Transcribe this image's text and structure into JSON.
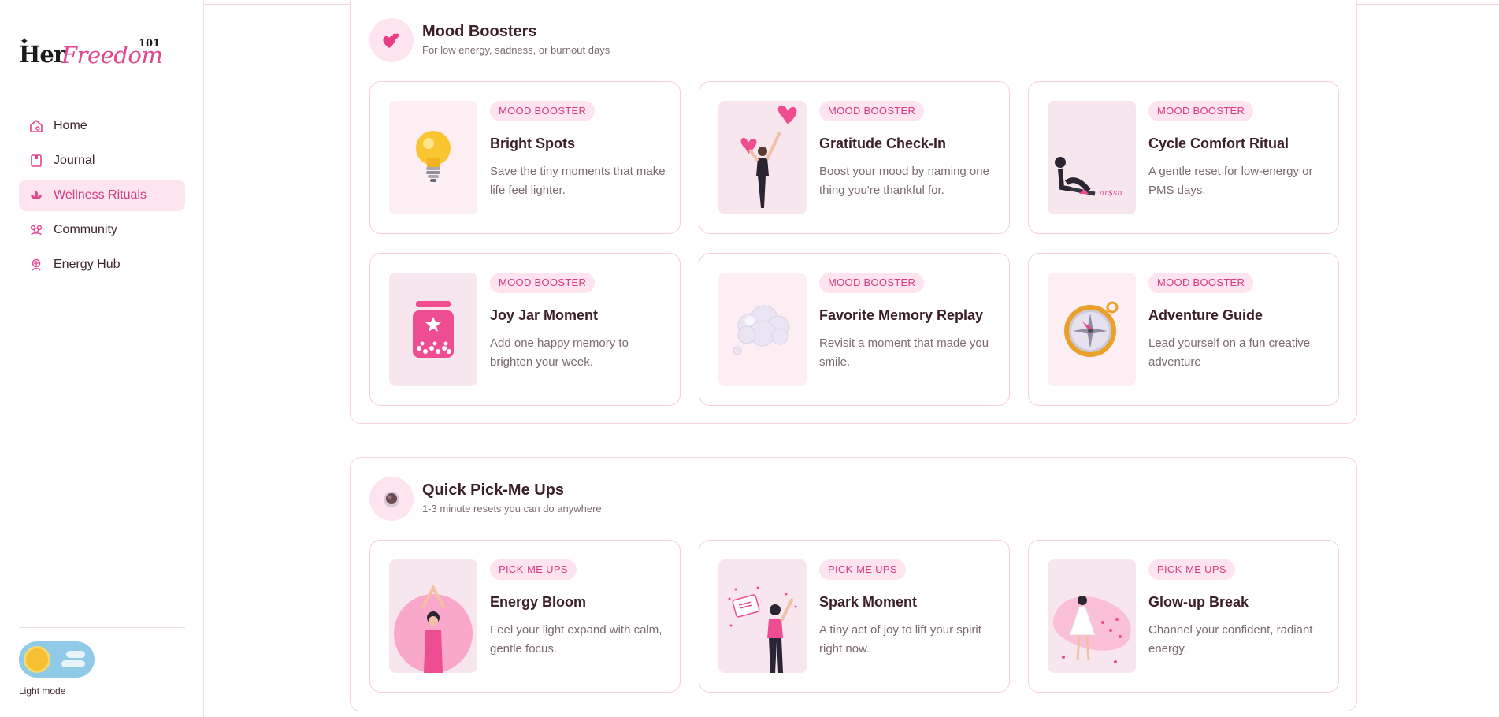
{
  "sidebar": {
    "logo": {
      "her": "Her",
      "freedom": "Freedom",
      "num": "101"
    },
    "items": [
      {
        "label": "Home",
        "icon": "home-icon",
        "active": false
      },
      {
        "label": "Journal",
        "icon": "journal-icon",
        "active": false
      },
      {
        "label": "Wellness Rituals",
        "icon": "lotus-icon",
        "active": true
      },
      {
        "label": "Community",
        "icon": "community-icon",
        "active": false
      },
      {
        "label": "Energy Hub",
        "icon": "energy-icon",
        "active": false
      }
    ],
    "mode_label": "Light mode"
  },
  "colors": {
    "accent": "#d63a82",
    "badge_bg": "#fde4ef",
    "border": "#f6cfdf",
    "toggle": "#8fcbe6"
  },
  "sections": [
    {
      "title": "Mood Boosters",
      "subtitle": "For low energy, sadness, or burnout days",
      "icon": "hearts-icon",
      "cards": [
        {
          "badge": "MOOD BOOSTER",
          "title": "Bright Spots",
          "desc": "Save the tiny moments that make life feel lighter.",
          "icon": "lightbulb-icon"
        },
        {
          "badge": "MOOD BOOSTER",
          "title": "Gratitude Check-In",
          "desc": "Boost your mood by naming one thing you're thankful for.",
          "icon": "woman-hearts-illustration"
        },
        {
          "badge": "MOOD BOOSTER",
          "title": "Cycle Comfort Ritual",
          "desc": "A gentle reset for low-energy or PMS days.",
          "icon": "woman-sitting-illustration"
        },
        {
          "badge": "MOOD BOOSTER",
          "title": "Joy Jar Moment",
          "desc": "Add one happy memory to brighten your week.",
          "icon": "jar-icon"
        },
        {
          "badge": "MOOD BOOSTER",
          "title": "Favorite Memory Replay",
          "desc": "Revisit a moment that made you smile.",
          "icon": "thought-cloud-icon"
        },
        {
          "badge": "MOOD BOOSTER",
          "title": "Adventure Guide",
          "desc": "Lead yourself on a fun creative adventure",
          "icon": "compass-icon"
        }
      ]
    },
    {
      "title": "Quick Pick-Me Ups",
      "subtitle": "1-3 minute resets you can do anywhere",
      "icon": "coffee-cup-icon",
      "cards": [
        {
          "badge": "PICK-ME UPS",
          "title": "Energy Bloom",
          "desc": "Feel your light expand with calm, gentle focus.",
          "icon": "woman-meditating-illustration"
        },
        {
          "badge": "PICK-ME UPS",
          "title": "Spark Moment",
          "desc": "A tiny act of joy to lift your spirit right now.",
          "icon": "woman-celebrating-illustration"
        },
        {
          "badge": "PICK-ME UPS",
          "title": "Glow-up Break",
          "desc": "Channel your confident, radiant energy.",
          "icon": "woman-dress-illustration"
        }
      ]
    }
  ]
}
